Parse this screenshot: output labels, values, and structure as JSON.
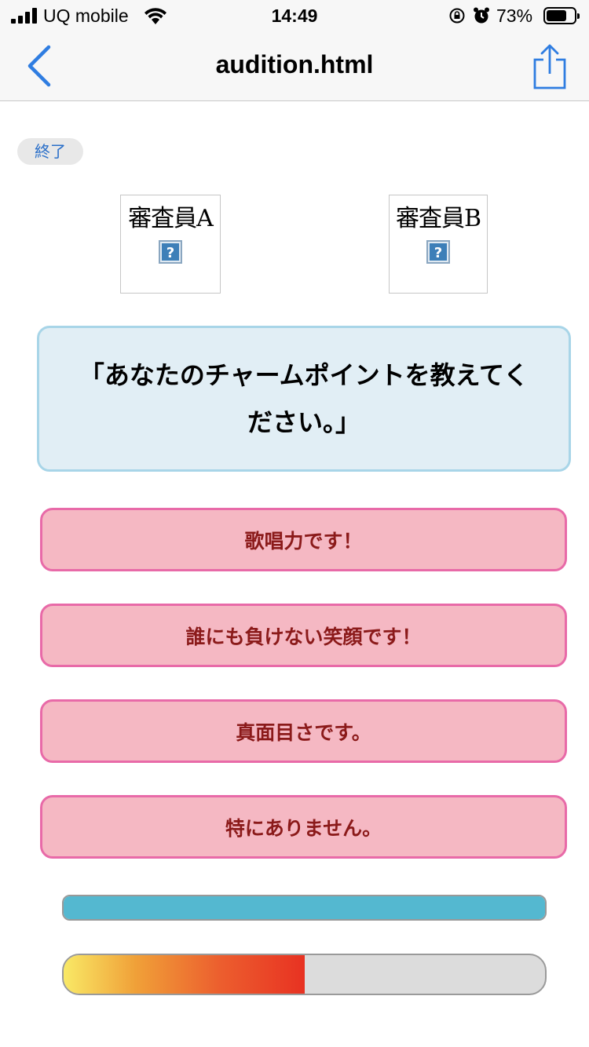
{
  "status_bar": {
    "carrier": "UQ mobile",
    "time": "14:49",
    "battery_percent": "73%",
    "battery_level": 0.73,
    "icons": [
      "signal-icon",
      "wifi-icon",
      "rotation-lock-icon",
      "alarm-icon",
      "battery-icon"
    ]
  },
  "nav": {
    "title": "audition.html",
    "back_icon": "chevron-left-icon",
    "share_icon": "share-icon",
    "accent": "#2f7de1"
  },
  "page": {
    "end_button": "終了",
    "judges": [
      {
        "name": "審査員A",
        "image_icon": "broken-image-icon"
      },
      {
        "name": "審査員B",
        "image_icon": "broken-image-icon"
      }
    ],
    "question": "「あなたのチャームポイントを教えてください。」",
    "answers": [
      "歌唱力です！",
      "誰にも負けない笑顔です！",
      "真面目さです。",
      "特にありません。"
    ],
    "time_bar": {
      "fraction": 1.0,
      "color": "#54b8d0"
    },
    "score_bar": {
      "fraction": 0.5
    }
  }
}
